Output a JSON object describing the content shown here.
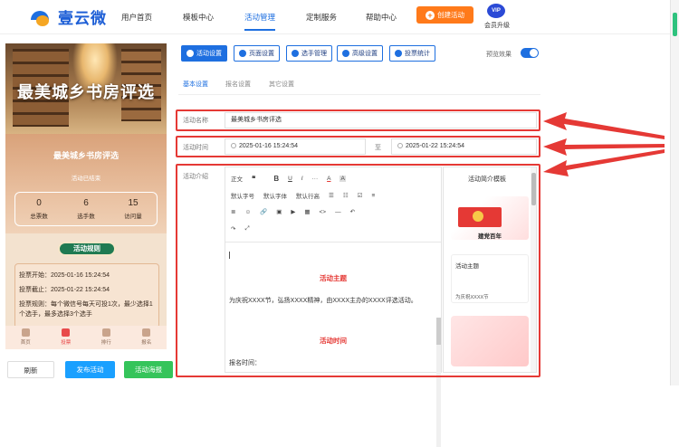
{
  "header": {
    "logo_text": "壹云微",
    "nav": [
      "用户首页",
      "模板中心",
      "活动管理",
      "定制服务",
      "帮助中心"
    ],
    "active_nav": "活动管理",
    "create_button": "创建活动",
    "vip_badge": "VIP",
    "vip_label": "会员升级"
  },
  "preview": {
    "banner_title": "最美城乡书房评选",
    "event_name": "最美城乡书房评选",
    "event_status": "活动已结束",
    "stats": [
      {
        "value": "0",
        "label": "总票数"
      },
      {
        "value": "6",
        "label": "选手数"
      },
      {
        "value": "15",
        "label": "访问量"
      }
    ],
    "rules_button": "活动规则",
    "rules": [
      "投票开始：2025-01-16 15:24:54",
      "投票截止：2025-01-22 15:24:54",
      "投票规则：每个微信号每天可投1次，最少选择1个选手，最多选择3个选手"
    ],
    "tabs": [
      "首页",
      "投票",
      "排行",
      "报名"
    ],
    "active_tab": "投票"
  },
  "bottom_buttons": {
    "refresh": "刷新",
    "publish": "发布活动",
    "poster": "活动海报"
  },
  "toolbar": {
    "buttons": [
      "活动设置",
      "页面设置",
      "选手管理",
      "高级设置",
      "投票统计"
    ],
    "active": "活动设置",
    "preview_label": "预览效果",
    "preview_on": true
  },
  "subtabs": [
    "基本设置",
    "报名设置",
    "其它设置"
  ],
  "form": {
    "name_label": "活动名称",
    "name_value": "最美城乡书房评选",
    "time_label": "活动时间",
    "start_time": "2025-01-16 15:24:54",
    "to_label": "至",
    "end_time": "2025-01-22 15:24:54",
    "intro_label": "活动介绍"
  },
  "editor": {
    "toolbar_row1": [
      "正文",
      "❝",
      "B",
      "U",
      "I",
      "···",
      "A",
      "A"
    ],
    "toolbar_row2": [
      "默认字号",
      "默认字体",
      "默认行高",
      "☰",
      "☷",
      "☑",
      "≡"
    ],
    "toolbar_row3": [
      "≣",
      "☺",
      "🔗",
      "▣",
      "▶",
      "▦",
      "<>",
      "—",
      "↶"
    ],
    "toolbar_row4": [
      "↷",
      "⤢"
    ],
    "heading1": "活动主题",
    "paragraph1": "为庆祝XXXX节，弘扬XXXX精神，由XXXX主办的XXXX评选活动。",
    "heading2": "活动时间",
    "signup_label": "报名时间："
  },
  "templates": {
    "title": "活动简介模板",
    "card1_caption": "建党百年",
    "card2_title": "活动主题",
    "card2_text": "为庆祝XXXX节"
  },
  "colors": {
    "brand_blue": "#1e6fe0",
    "accent_orange": "#ff7a1a",
    "highlight_red": "#e53935",
    "publish_blue": "#1aa0ff",
    "poster_green": "#35c45a"
  }
}
